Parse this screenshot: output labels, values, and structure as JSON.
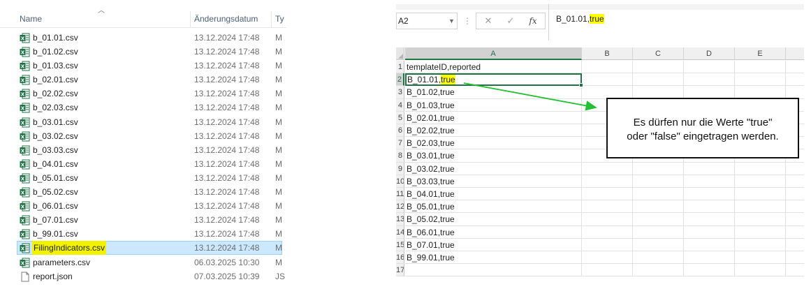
{
  "explorer": {
    "columns": {
      "name": "Name",
      "date": "Änderungsdatum",
      "type": "Ty"
    },
    "files": [
      {
        "name": "b_01.01.csv",
        "date": "13.12.2024 17:48",
        "type": "M",
        "icon": "excel-csv-icon"
      },
      {
        "name": "b_01.02.csv",
        "date": "13.12.2024 17:48",
        "type": "M",
        "icon": "excel-csv-icon"
      },
      {
        "name": "b_01.03.csv",
        "date": "13.12.2024 17:48",
        "type": "M",
        "icon": "excel-csv-icon"
      },
      {
        "name": "b_02.01.csv",
        "date": "13.12.2024 17:48",
        "type": "M",
        "icon": "excel-csv-icon"
      },
      {
        "name": "b_02.02.csv",
        "date": "13.12.2024 17:48",
        "type": "M",
        "icon": "excel-csv-icon"
      },
      {
        "name": "b_02.03.csv",
        "date": "13.12.2024 17:48",
        "type": "M",
        "icon": "excel-csv-icon"
      },
      {
        "name": "b_03.01.csv",
        "date": "13.12.2024 17:48",
        "type": "M",
        "icon": "excel-csv-icon"
      },
      {
        "name": "b_03.02.csv",
        "date": "13.12.2024 17:48",
        "type": "M",
        "icon": "excel-csv-icon"
      },
      {
        "name": "b_03.03.csv",
        "date": "13.12.2024 17:48",
        "type": "M",
        "icon": "excel-csv-icon"
      },
      {
        "name": "b_04.01.csv",
        "date": "13.12.2024 17:48",
        "type": "M",
        "icon": "excel-csv-icon"
      },
      {
        "name": "b_05.01.csv",
        "date": "13.12.2024 17:48",
        "type": "M",
        "icon": "excel-csv-icon"
      },
      {
        "name": "b_05.02.csv",
        "date": "13.12.2024 17:48",
        "type": "M",
        "icon": "excel-csv-icon"
      },
      {
        "name": "b_06.01.csv",
        "date": "13.12.2024 17:48",
        "type": "M",
        "icon": "excel-csv-icon"
      },
      {
        "name": "b_07.01.csv",
        "date": "13.12.2024 17:48",
        "type": "M",
        "icon": "excel-csv-icon"
      },
      {
        "name": "b_99.01.csv",
        "date": "13.12.2024 17:48",
        "type": "M",
        "icon": "excel-csv-icon"
      },
      {
        "name": "FilingIndicators.csv",
        "date": "13.12.2024 17:48",
        "type": "M",
        "icon": "excel-csv-icon",
        "selected": true
      },
      {
        "name": "parameters.csv",
        "date": "06.03.2025 10:30",
        "type": "M",
        "icon": "excel-csv-icon"
      },
      {
        "name": "report.json",
        "date": "07.03.2025 10:39",
        "type": "JS",
        "icon": "document-icon"
      }
    ]
  },
  "excel": {
    "name_box": "A2",
    "formula_buttons": {
      "cancel": "✕",
      "enter": "✓",
      "fx": "fx"
    },
    "formula": {
      "prefix": "B_01.01,",
      "highlight": "true"
    },
    "columns": [
      "A",
      "B",
      "C",
      "D",
      "E"
    ],
    "row_numbers": [
      "1",
      "2",
      "3",
      "4",
      "5",
      "6",
      "7",
      "8",
      "9",
      "10",
      "11",
      "12",
      "13",
      "14",
      "15",
      "16",
      "17"
    ],
    "cells_a": [
      "templateID,reported",
      "B_01.01,",
      "B_01.02,true",
      "B_01.03,true",
      "B_02.01,true",
      "B_02.02,true",
      "B_02.03,true",
      "B_03.01,true",
      "B_03.02,true",
      "B_03.03,true",
      "B_04.01,true",
      "B_05.01,true",
      "B_05.02,true",
      "B_06.01,true",
      "B_07.01,true",
      "B_99.01,true",
      ""
    ],
    "a2_highlight": "true"
  },
  "callout": {
    "line1": "Es dürfen nur die Werte \"true\"",
    "line2": "oder \"false\" eingetragen werden."
  },
  "colors": {
    "excel_green": "#217346",
    "selection_blue": "#cce8ff",
    "highlight_yellow": "#ffff00",
    "arrow_green": "#22c032"
  }
}
